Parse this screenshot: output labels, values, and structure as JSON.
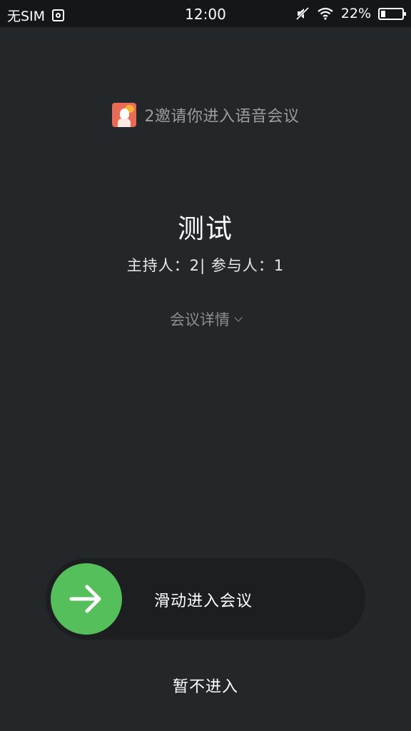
{
  "status_bar": {
    "carrier": "无SIM",
    "time": "12:00",
    "battery_percent": "22%"
  },
  "invite": {
    "text": "2邀请你进入语音会议"
  },
  "meeting": {
    "title": "测试",
    "participants": "主持人：2| 参与人：1",
    "details_label": "会议详情"
  },
  "actions": {
    "slide_label": "滑动进入会议",
    "decline_label": "暂不进入"
  },
  "colors": {
    "background": "#23272a",
    "accent_green": "#55bf5b"
  }
}
